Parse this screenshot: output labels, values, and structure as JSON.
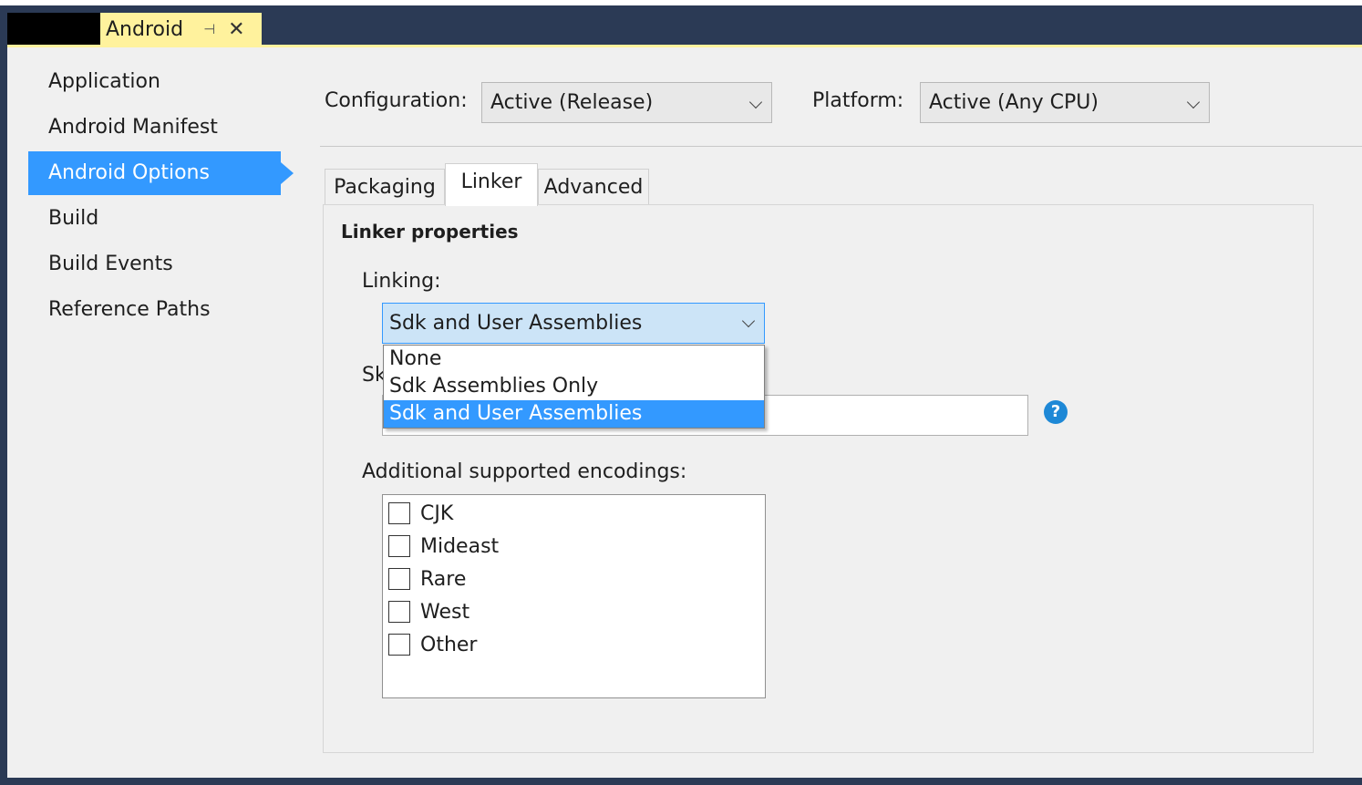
{
  "document_tab": {
    "title": "Android",
    "pin": "⊣",
    "close": "✕"
  },
  "sidebar": {
    "items": [
      {
        "label": "Application"
      },
      {
        "label": "Android Manifest"
      },
      {
        "label": "Android Options"
      },
      {
        "label": "Build"
      },
      {
        "label": "Build Events"
      },
      {
        "label": "Reference Paths"
      }
    ],
    "selected": "Android Options"
  },
  "toolbar": {
    "configuration_label": "Configuration:",
    "configuration_value": "Active (Release)",
    "platform_label": "Platform:",
    "platform_value": "Active (Any CPU)"
  },
  "tabs": [
    {
      "label": "Packaging"
    },
    {
      "label": "Linker"
    },
    {
      "label": "Advanced"
    }
  ],
  "active_tab": "Linker",
  "linker": {
    "section_title": "Linker properties",
    "linking_label": "Linking:",
    "linking_value": "Sdk and User Assemblies",
    "linking_options": [
      "None",
      "Sdk Assemblies Only",
      "Sdk and User Assemblies"
    ],
    "skip_label_partial": "Sk",
    "help_glyph": "?",
    "encodings_label": "Additional supported encodings:",
    "encodings": [
      "CJK",
      "Mideast",
      "Rare",
      "West",
      "Other"
    ]
  },
  "colors": {
    "accent": "#3399ff",
    "tab_yellow": "#fff29d",
    "frame": "#2b3a55",
    "panel_bg": "#f0f0f0"
  }
}
